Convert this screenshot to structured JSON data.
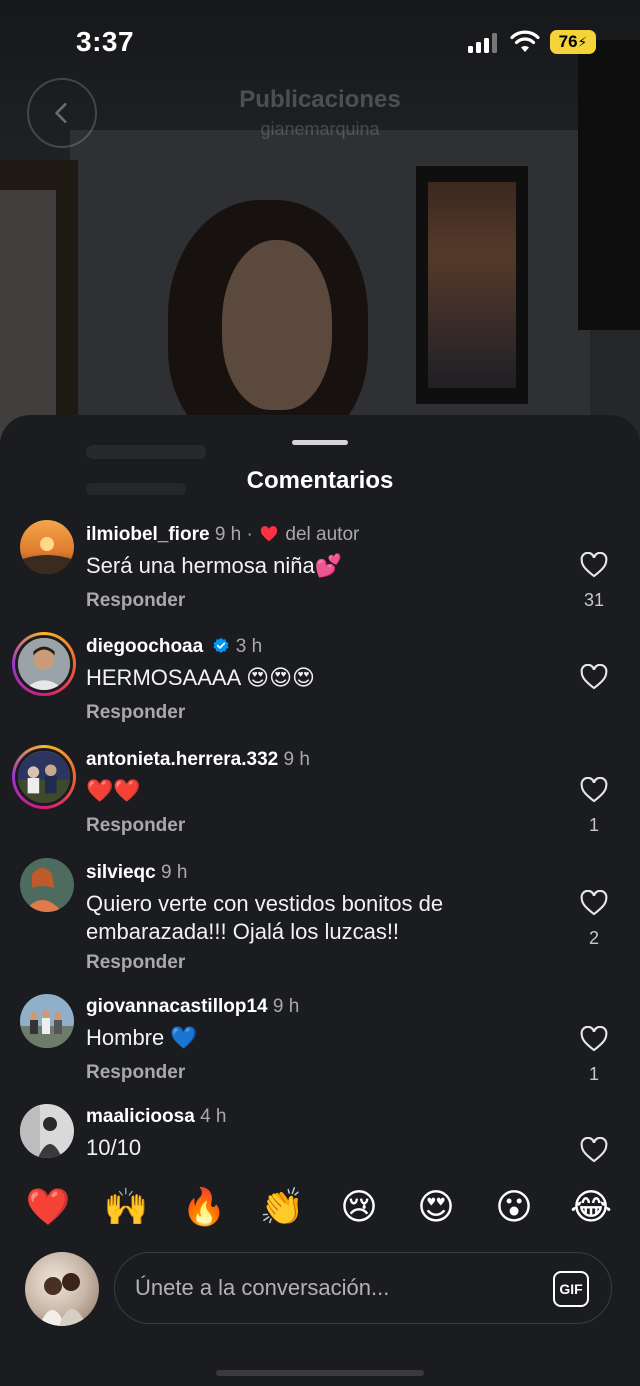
{
  "status_bar": {
    "time": "3:37",
    "battery": "76"
  },
  "post": {
    "title": "Publicaciones",
    "username": "gianemarquina"
  },
  "sheet": {
    "title": "Comentarios"
  },
  "comments": [
    {
      "user": "ilmiobel_fiore",
      "age": "9 h",
      "separator": "·",
      "liked_by_author": "del autor",
      "text": "Será una hermosa niña💕",
      "reply": "Responder",
      "likes": "31"
    },
    {
      "user": "diegoochoaa",
      "age": "3 h",
      "text": "HERMOSAAAA 😍😍😍",
      "reply": "Responder",
      "likes": ""
    },
    {
      "user": "antonieta.herrera.332",
      "age": "9 h",
      "text": "❤️❤️",
      "reply": "Responder",
      "likes": "1"
    },
    {
      "user": "silvieqc",
      "age": "9 h",
      "text": "Quiero verte con vestidos bonitos de embarazada!!! Ojalá los luzcas!!",
      "reply": "Responder",
      "likes": "2"
    },
    {
      "user": "giovannacastillop14",
      "age": "9 h",
      "text": "Hombre 💙",
      "reply": "Responder",
      "likes": "1"
    },
    {
      "user": "maalicioosa",
      "age": "4 h",
      "text": "10/10",
      "reply": "",
      "likes": ""
    }
  ],
  "quick_reactions": [
    "❤️",
    "🙌",
    "🔥",
    "👏",
    "😢",
    "😍",
    "😮",
    "😂"
  ],
  "composer": {
    "placeholder": "Únete a la conversación...",
    "gif_label": "GIF"
  },
  "colors": {
    "sheet_bg": "#1b1c20",
    "secondary_text": "#a8a8ad",
    "like_red": "#ff3040",
    "verified_blue": "#0095f6",
    "battery_yellow": "#f5d43a"
  }
}
